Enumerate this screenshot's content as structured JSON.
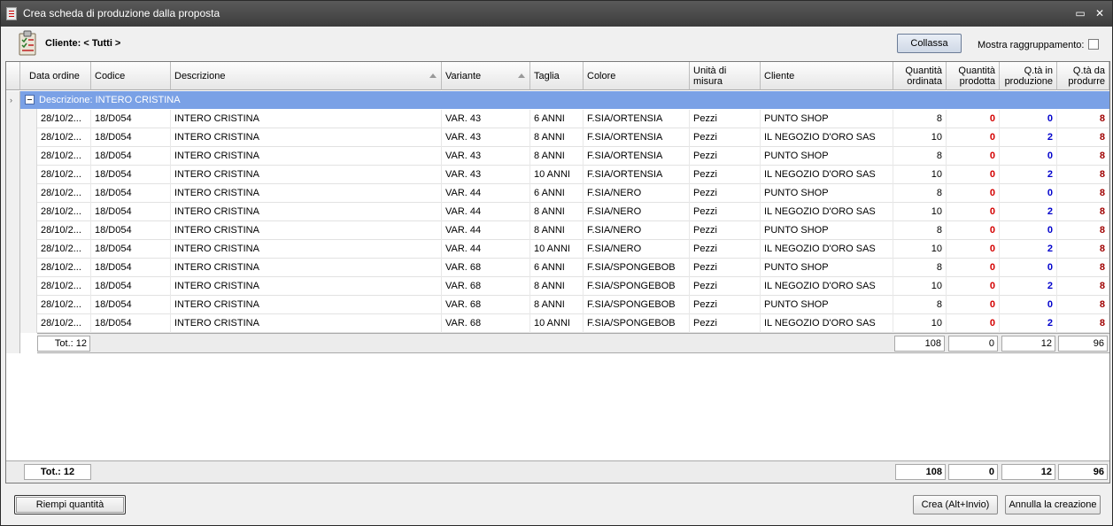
{
  "window": {
    "title": "Crea scheda di produzione dalla proposta",
    "minimize_glyph": "▭",
    "close_glyph": "✕"
  },
  "header": {
    "client_label": "Cliente: < Tutti >",
    "collapse_label": "Collassa",
    "grouping_label": "Mostra raggruppamento:",
    "grouping_checked": false
  },
  "columns": {
    "data_ordine": "Data ordine",
    "codice": "Codice",
    "descrizione": "Descrizione",
    "variante": "Variante",
    "taglia": "Taglia",
    "colore": "Colore",
    "unita": "Unità di misura",
    "cliente": "Cliente",
    "qta_ordinata": "Quantità ordinata",
    "qta_prodotta": "Quantità prodotta",
    "qta_in_produzione": "Q.tà in produzione",
    "qta_da_produrre": "Q.tà da produrre"
  },
  "group": {
    "label": "Descrizione: INTERO CRISTINA",
    "pointer": "›"
  },
  "rows": [
    {
      "data": "28/10/2...",
      "codice": "18/D054",
      "descrizione": "INTERO CRISTINA",
      "variante": "VAR. 43",
      "taglia": "6 ANNI",
      "colore": "F.SIA/ORTENSIA",
      "unita": "Pezzi",
      "cliente": "PUNTO SHOP",
      "ordinata": "8",
      "prodotta": "0",
      "in_produzione": "0",
      "da_produrre": "8"
    },
    {
      "data": "28/10/2...",
      "codice": "18/D054",
      "descrizione": "INTERO CRISTINA",
      "variante": "VAR. 43",
      "taglia": "8 ANNI",
      "colore": "F.SIA/ORTENSIA",
      "unita": "Pezzi",
      "cliente": "IL NEGOZIO D'ORO SAS",
      "ordinata": "10",
      "prodotta": "0",
      "in_produzione": "2",
      "da_produrre": "8"
    },
    {
      "data": "28/10/2...",
      "codice": "18/D054",
      "descrizione": "INTERO CRISTINA",
      "variante": "VAR. 43",
      "taglia": "8 ANNI",
      "colore": "F.SIA/ORTENSIA",
      "unita": "Pezzi",
      "cliente": "PUNTO SHOP",
      "ordinata": "8",
      "prodotta": "0",
      "in_produzione": "0",
      "da_produrre": "8"
    },
    {
      "data": "28/10/2...",
      "codice": "18/D054",
      "descrizione": "INTERO CRISTINA",
      "variante": "VAR. 43",
      "taglia": "10 ANNI",
      "colore": "F.SIA/ORTENSIA",
      "unita": "Pezzi",
      "cliente": "IL NEGOZIO D'ORO SAS",
      "ordinata": "10",
      "prodotta": "0",
      "in_produzione": "2",
      "da_produrre": "8"
    },
    {
      "data": "28/10/2...",
      "codice": "18/D054",
      "descrizione": "INTERO CRISTINA",
      "variante": "VAR. 44",
      "taglia": "6 ANNI",
      "colore": "F.SIA/NERO",
      "unita": "Pezzi",
      "cliente": "PUNTO SHOP",
      "ordinata": "8",
      "prodotta": "0",
      "in_produzione": "0",
      "da_produrre": "8"
    },
    {
      "data": "28/10/2...",
      "codice": "18/D054",
      "descrizione": "INTERO CRISTINA",
      "variante": "VAR. 44",
      "taglia": "8 ANNI",
      "colore": "F.SIA/NERO",
      "unita": "Pezzi",
      "cliente": "IL NEGOZIO D'ORO SAS",
      "ordinata": "10",
      "prodotta": "0",
      "in_produzione": "2",
      "da_produrre": "8"
    },
    {
      "data": "28/10/2...",
      "codice": "18/D054",
      "descrizione": "INTERO CRISTINA",
      "variante": "VAR. 44",
      "taglia": "8 ANNI",
      "colore": "F.SIA/NERO",
      "unita": "Pezzi",
      "cliente": "PUNTO SHOP",
      "ordinata": "8",
      "prodotta": "0",
      "in_produzione": "0",
      "da_produrre": "8"
    },
    {
      "data": "28/10/2...",
      "codice": "18/D054",
      "descrizione": "INTERO CRISTINA",
      "variante": "VAR. 44",
      "taglia": "10 ANNI",
      "colore": "F.SIA/NERO",
      "unita": "Pezzi",
      "cliente": "IL NEGOZIO D'ORO SAS",
      "ordinata": "10",
      "prodotta": "0",
      "in_produzione": "2",
      "da_produrre": "8"
    },
    {
      "data": "28/10/2...",
      "codice": "18/D054",
      "descrizione": "INTERO CRISTINA",
      "variante": "VAR. 68",
      "taglia": "6 ANNI",
      "colore": "F.SIA/SPONGEBOB",
      "unita": "Pezzi",
      "cliente": "PUNTO SHOP",
      "ordinata": "8",
      "prodotta": "0",
      "in_produzione": "0",
      "da_produrre": "8"
    },
    {
      "data": "28/10/2...",
      "codice": "18/D054",
      "descrizione": "INTERO CRISTINA",
      "variante": "VAR. 68",
      "taglia": "8 ANNI",
      "colore": "F.SIA/SPONGEBOB",
      "unita": "Pezzi",
      "cliente": "IL NEGOZIO D'ORO SAS",
      "ordinata": "10",
      "prodotta": "0",
      "in_produzione": "2",
      "da_produrre": "8"
    },
    {
      "data": "28/10/2...",
      "codice": "18/D054",
      "descrizione": "INTERO CRISTINA",
      "variante": "VAR. 68",
      "taglia": "8 ANNI",
      "colore": "F.SIA/SPONGEBOB",
      "unita": "Pezzi",
      "cliente": "PUNTO SHOP",
      "ordinata": "8",
      "prodotta": "0",
      "in_produzione": "0",
      "da_produrre": "8"
    },
    {
      "data": "28/10/2...",
      "codice": "18/D054",
      "descrizione": "INTERO CRISTINA",
      "variante": "VAR. 68",
      "taglia": "10 ANNI",
      "colore": "F.SIA/SPONGEBOB",
      "unita": "Pezzi",
      "cliente": "IL NEGOZIO D'ORO SAS",
      "ordinata": "10",
      "prodotta": "0",
      "in_produzione": "2",
      "da_produrre": "8"
    }
  ],
  "group_totals": {
    "count": "Tot.: 12",
    "ordinata": "108",
    "prodotta": "0",
    "in_produzione": "12",
    "da_produrre": "96"
  },
  "grand_totals": {
    "count": "Tot.: 12",
    "ordinata": "108",
    "prodotta": "0",
    "in_produzione": "12",
    "da_produrre": "96"
  },
  "buttons": {
    "fill": "Riempi quantità",
    "create": "Crea (Alt+Invio)",
    "cancel": "Annulla la creazione"
  },
  "colors": {
    "group_row": "#7aa1e6",
    "zero_red": "#d40000",
    "in_prod_blue": "#0000cc",
    "to_produce_red": "#a00000"
  }
}
